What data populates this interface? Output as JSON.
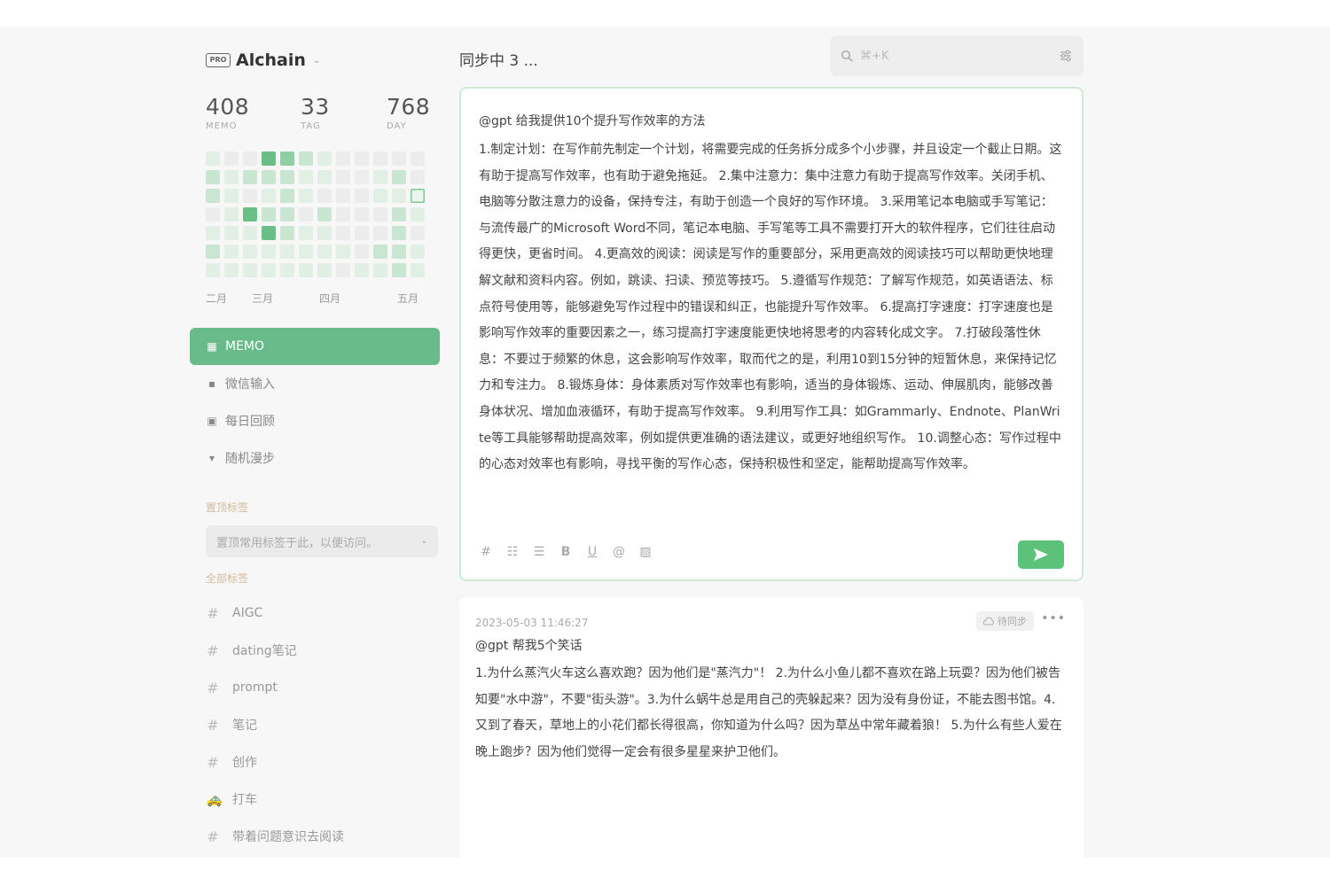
{
  "user": {
    "badge": "PRO",
    "name": "Alchain",
    "caret": "⌄"
  },
  "stats": [
    {
      "value": "408",
      "label": "MEMO"
    },
    {
      "value": "33",
      "label": "TAG"
    },
    {
      "value": "768",
      "label": "DAY"
    }
  ],
  "heatmap": {
    "columns": 12,
    "rows": [
      [
        1,
        0,
        0,
        4,
        3,
        2,
        1,
        0,
        0,
        0,
        0,
        0
      ],
      [
        2,
        1,
        2,
        2,
        2,
        1,
        1,
        0,
        0,
        1,
        2,
        0
      ],
      [
        2,
        1,
        0,
        1,
        2,
        1,
        0,
        0,
        0,
        1,
        1,
        2
      ],
      [
        0,
        1,
        4,
        2,
        2,
        0,
        2,
        0,
        0,
        0,
        2,
        1
      ],
      [
        1,
        1,
        1,
        4,
        2,
        1,
        1,
        0,
        0,
        0,
        2,
        0
      ],
      [
        2,
        1,
        1,
        1,
        1,
        1,
        1,
        1,
        0,
        2,
        2,
        1
      ],
      [
        1,
        1,
        1,
        1,
        1,
        1,
        1,
        0,
        1,
        1,
        2,
        1
      ]
    ],
    "highlight": {
      "row": 2,
      "col": 11
    },
    "months": [
      "二月",
      "三月",
      "四月",
      "五月"
    ]
  },
  "nav": [
    {
      "label": "MEMO",
      "icon": "grid-icon",
      "glyph": "▦",
      "active": true
    },
    {
      "label": "微信输入",
      "icon": "chat-icon",
      "glyph": "▪",
      "active": false
    },
    {
      "label": "每日回顾",
      "icon": "calendar-icon",
      "glyph": "▣",
      "active": false
    },
    {
      "label": "随机漫步",
      "icon": "walk-icon",
      "glyph": "▾",
      "active": false
    }
  ],
  "pinned": {
    "label": "置顶标签",
    "placeholder": "置顶常用标签于此，以便访问。"
  },
  "all_tags": {
    "label": "全部标签",
    "items": [
      {
        "label": "AIGC",
        "icon": "#"
      },
      {
        "label": "dating笔记",
        "icon": "#"
      },
      {
        "label": "prompt",
        "icon": "#"
      },
      {
        "label": "笔记",
        "icon": "#"
      },
      {
        "label": "创作",
        "icon": "#"
      },
      {
        "label": "打车",
        "icon": "🚕"
      },
      {
        "label": "带着问题意识去阅读",
        "icon": "#"
      }
    ]
  },
  "header": {
    "sync_status": "同步中 3 ..."
  },
  "search": {
    "placeholder": "⌘+K"
  },
  "editor": {
    "prompt": "@gpt 给我提供10个提升写作效率的方法",
    "body": "1.制定计划：在写作前先制定一个计划，将需要完成的任务拆分成多个小步骤，并且设定一个截止日期。这有助于提高写作效率，也有助于避免拖延。 2.集中注意力：集中注意力有助于提高写作效率。关闭手机、电脑等分散注意力的设备，保持专注，有助于创造一个良好的写作环境。 3.采用笔记本电脑或手写笔记：与流传最广的Microsoft Word不同，笔记本电脑、手写笔等工具不需要打开大的软件程序，它们往往启动得更快，更省时间。 4.更高效的阅读：阅读是写作的重要部分，采用更高效的阅读技巧可以帮助更快地理解文献和资料内容。例如，跳读、扫读、预览等技巧。 5.遵循写作规范：了解写作规范，如英语语法、标点符号使用等，能够避免写作过程中的错误和纠正，也能提升写作效率。 6.提高打字速度：打字速度也是影响写作效率的重要因素之一，练习提高打字速度能更快地将思考的内容转化成文字。 7.打破段落性休息：不要过于频繁的休息，这会影响写作效率，取而代之的是，利用10到15分钟的短暂休息，来保持记忆力和专注力。 8.锻炼身体：身体素质对写作效率也有影响，适当的身体锻炼、运动、伸展肌肉，能够改善身体状况、增加血液循环，有助于提高写作效率。 9.利用写作工具：如Grammarly、Endnote、PlanWrite等工具能够帮助提高效率，例如提供更准确的语法建议，或更好地组织写作。 10.调整心态：写作过程中的心态对效率也有影响，寻找平衡的写作心态，保持积极性和坚定，能帮助提高写作效率。",
    "toolbar": [
      {
        "name": "hashtag-icon",
        "glyph": "#"
      },
      {
        "name": "unordered-list-icon",
        "glyph": "☷"
      },
      {
        "name": "ordered-list-icon",
        "glyph": "☰"
      },
      {
        "name": "bold-icon",
        "glyph": "B"
      },
      {
        "name": "underline-icon",
        "glyph": "U"
      },
      {
        "name": "mention-icon",
        "glyph": "@"
      },
      {
        "name": "image-icon",
        "glyph": "▨"
      }
    ]
  },
  "memo": {
    "timestamp": "2023-05-03 11:46:27",
    "sync_label": "待同步",
    "more": "•••",
    "prompt": "@gpt 帮我5个笑话",
    "body": "1.为什么蒸汽火车这么喜欢跑？因为他们是\"蒸汽力\"！ 2.为什么小鱼儿都不喜欢在路上玩耍？因为他们被告知要\"水中游\"，不要\"街头游\"。3.为什么蜗牛总是用自己的壳躲起来？因为没有身份证，不能去图书馆。4.又到了春天，草地上的小花们都长得很高，你知道为什么吗？因为草丛中常年藏着狼！ 5.为什么有些人爱在晚上跑步？因为他们觉得一定会有很多星星来护卫他们。"
  },
  "colors": {
    "accent": "#6abb8a",
    "send": "#5cc27a",
    "section_label": "#d3b99a",
    "editor_border": "#cfe9d7"
  }
}
